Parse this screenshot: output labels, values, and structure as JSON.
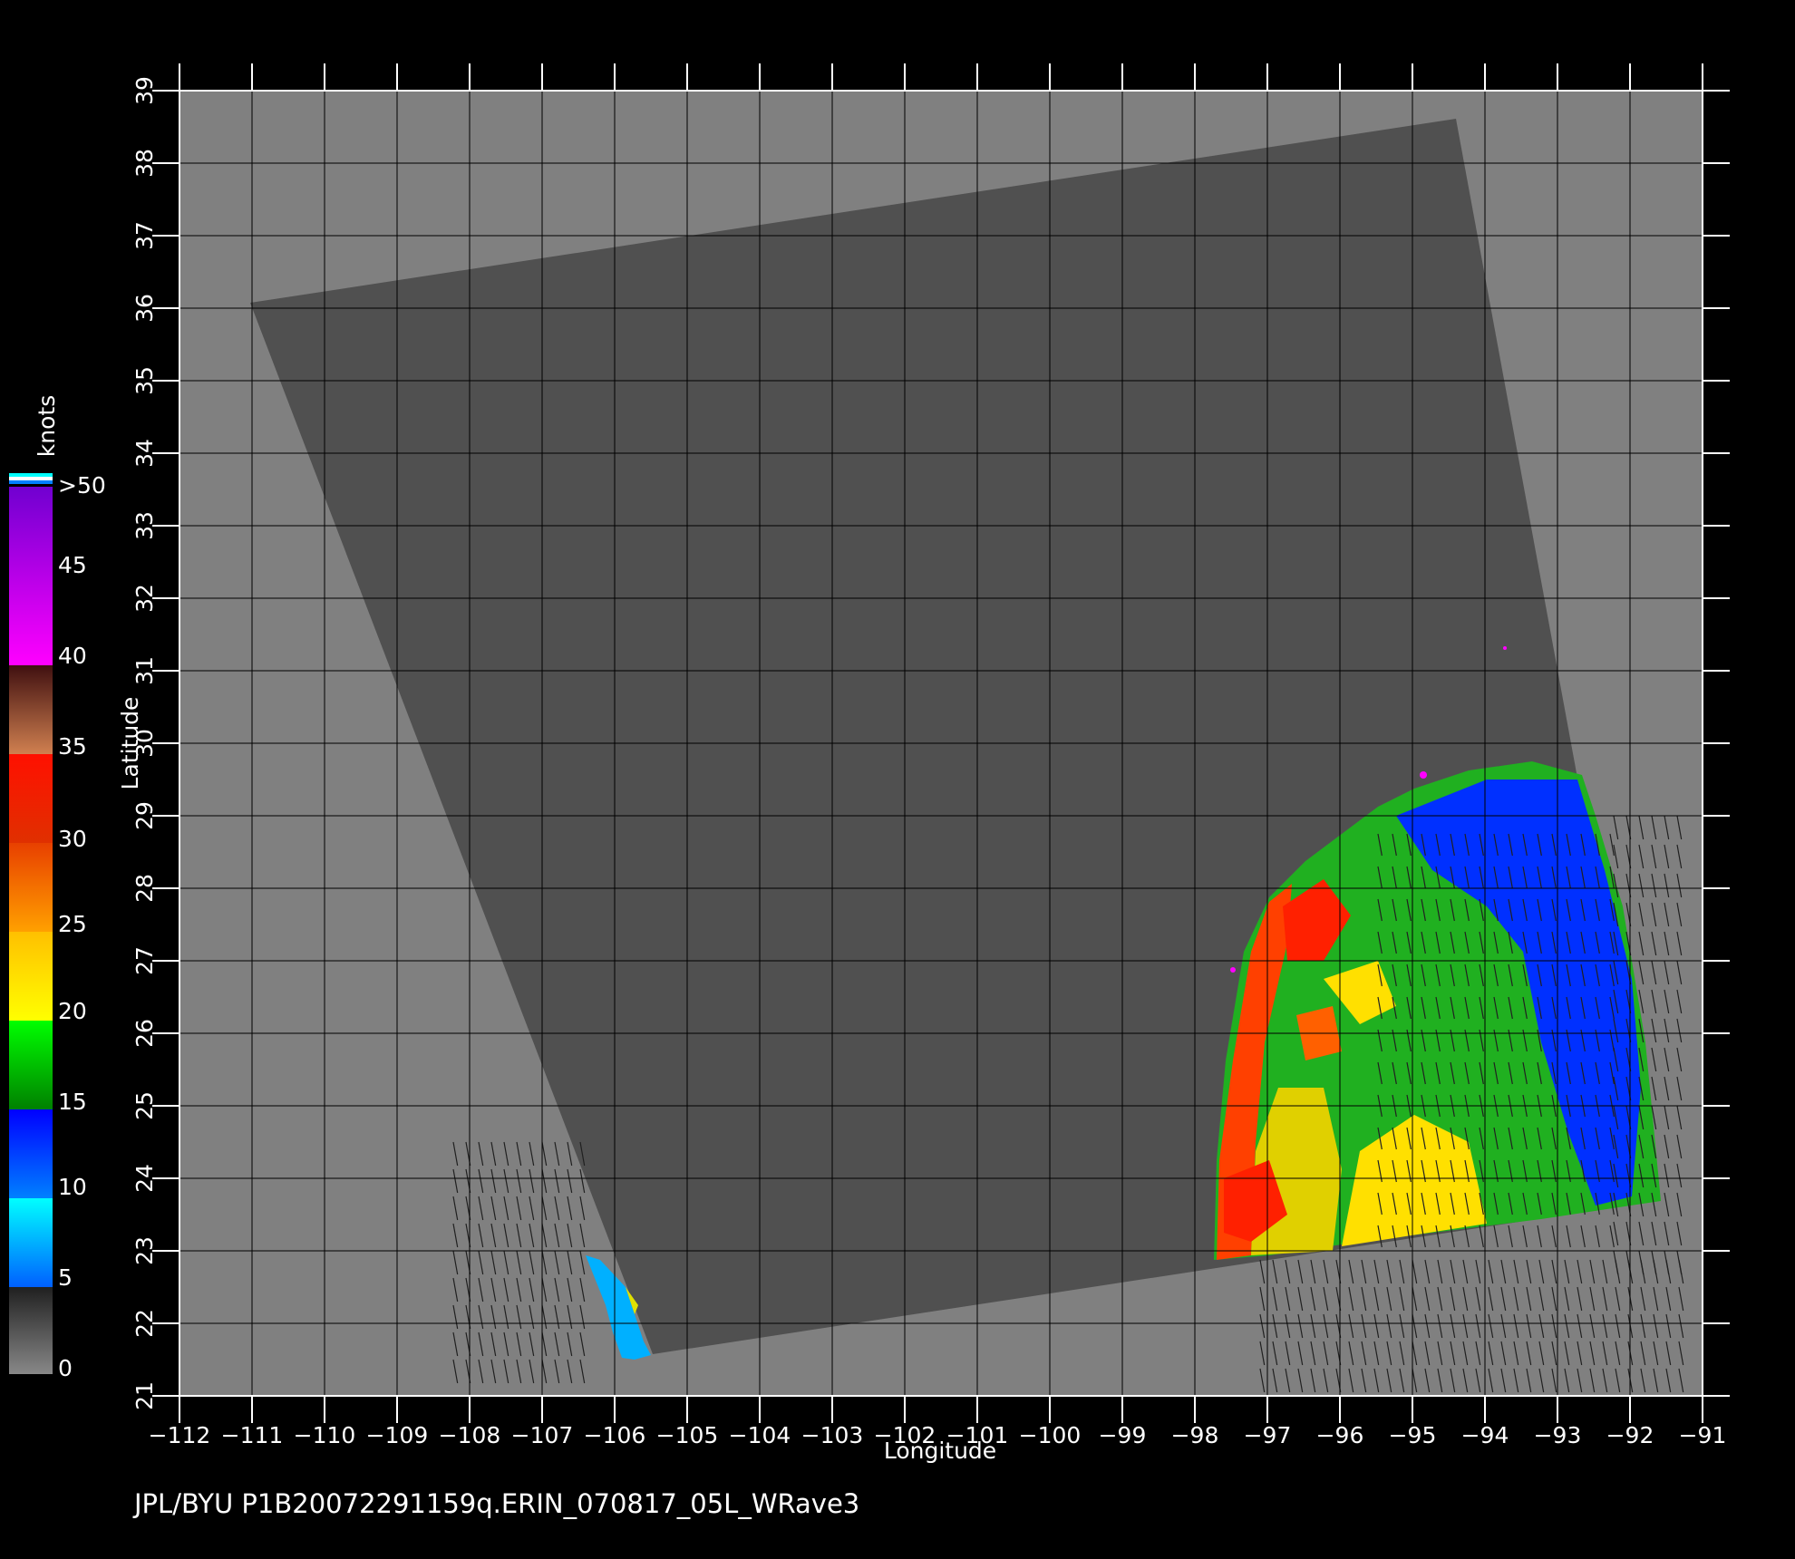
{
  "map": {
    "xlabel": "Longitude",
    "ylabel": "Latitude",
    "lon_ticks": [
      "−112",
      "−111",
      "−110",
      "−109",
      "−108",
      "−107",
      "−106",
      "−105",
      "−104",
      "−103",
      "−102",
      "−101",
      "−100",
      "−99",
      "−98",
      "−97",
      "−96",
      "−95",
      "−94",
      "−93",
      "−92",
      "−91"
    ],
    "lat_ticks": [
      "21",
      "22",
      "23",
      "24",
      "25",
      "26",
      "27",
      "28",
      "29",
      "30",
      "31",
      "32",
      "33",
      "34",
      "35",
      "36",
      "37",
      "38",
      "39"
    ],
    "lon_range": [
      -112,
      -91
    ],
    "lat_range": [
      21,
      39
    ],
    "swath_corners_lonlat": [
      [
        -111,
        36.1
      ],
      [
        -94.4,
        38.6
      ],
      [
        -91.5,
        23.7
      ],
      [
        -105.5,
        21.55
      ]
    ],
    "background_color": "#808080",
    "swath_color": "#505050"
  },
  "colorbar": {
    "unit": "knots",
    "labels": [
      ">50",
      "45",
      "40",
      "35",
      "30",
      "25",
      "20",
      "15",
      "10",
      "5",
      "0"
    ],
    "stops": [
      {
        "value": 0,
        "color": "#888888"
      },
      {
        "value": 5,
        "color": "#303030"
      },
      {
        "value": 5,
        "color": "#00ffff"
      },
      {
        "value": 10,
        "color": "#0080ff"
      },
      {
        "value": 15,
        "color": "#0000ff"
      },
      {
        "value": 15,
        "color": "#008000"
      },
      {
        "value": 20,
        "color": "#00ff00"
      },
      {
        "value": 20,
        "color": "#ffff00"
      },
      {
        "value": 25,
        "color": "#ff8000"
      },
      {
        "value": 30,
        "color": "#ff2000"
      },
      {
        "value": 35,
        "color": "#d08050"
      },
      {
        "value": 40,
        "color": "#401010"
      },
      {
        "value": 40,
        "color": "#ff00ff"
      },
      {
        "value": 50,
        "color": "#6000c0"
      }
    ]
  },
  "footer": {
    "caption": "JPL/BYU  P1B20072291159q.ERIN_070817_05L_WRave3"
  }
}
